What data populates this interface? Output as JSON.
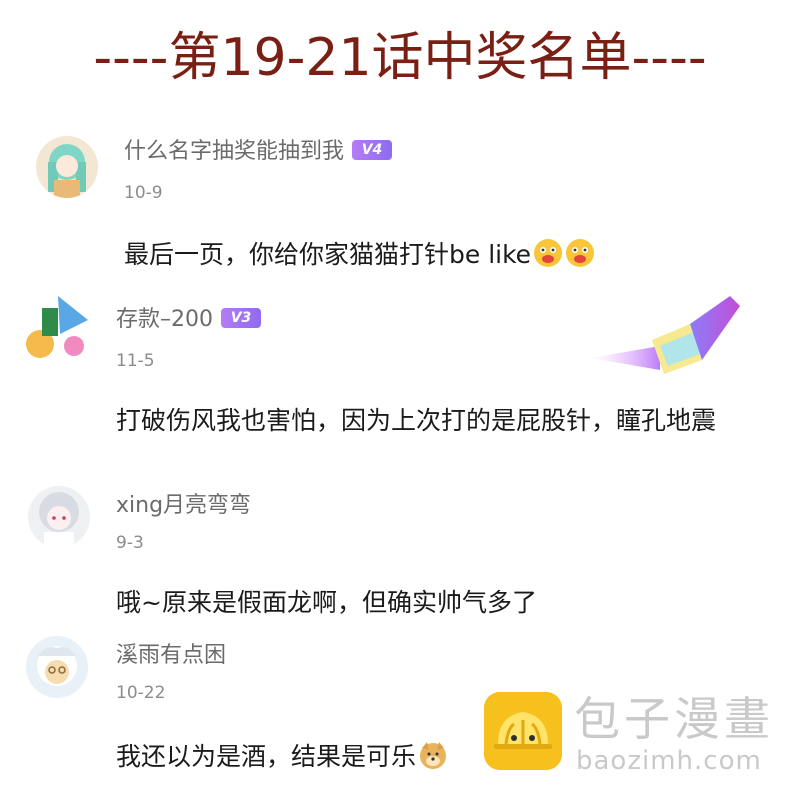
{
  "title": "----第19-21话中奖名单----",
  "comments": [
    {
      "username": "什么名字抽奖能抽到我",
      "level": "V4",
      "date": "10-9",
      "text": "最后一页，你给你家猫猫打针be like",
      "emojis": [
        "tongue-face-emoji",
        "tongue-face-emoji"
      ]
    },
    {
      "username": "存款–200",
      "level": "V3",
      "date": "11-5",
      "text": "打破伤风我也害怕，因为上次打的是屁股针，瞳孔地震"
    },
    {
      "username": "xing月亮弯弯",
      "date": "9-3",
      "text": "哦~原来是假面龙啊，但确实帅气多了"
    },
    {
      "username": "溪雨有点困",
      "date": "10-22",
      "text": "我还以为是酒，结果是可乐",
      "emojis": [
        "doge-emoji"
      ]
    }
  ],
  "watermark": {
    "name": "包子漫畫",
    "url": "baozimh.com"
  },
  "colors": {
    "title": "#7a1f14",
    "username": "#6b6b6b",
    "date": "#8b8b8b",
    "badge": "#a472f2",
    "watermark_logo": "#f7c11d",
    "watermark_text": "#c9c9c9"
  }
}
